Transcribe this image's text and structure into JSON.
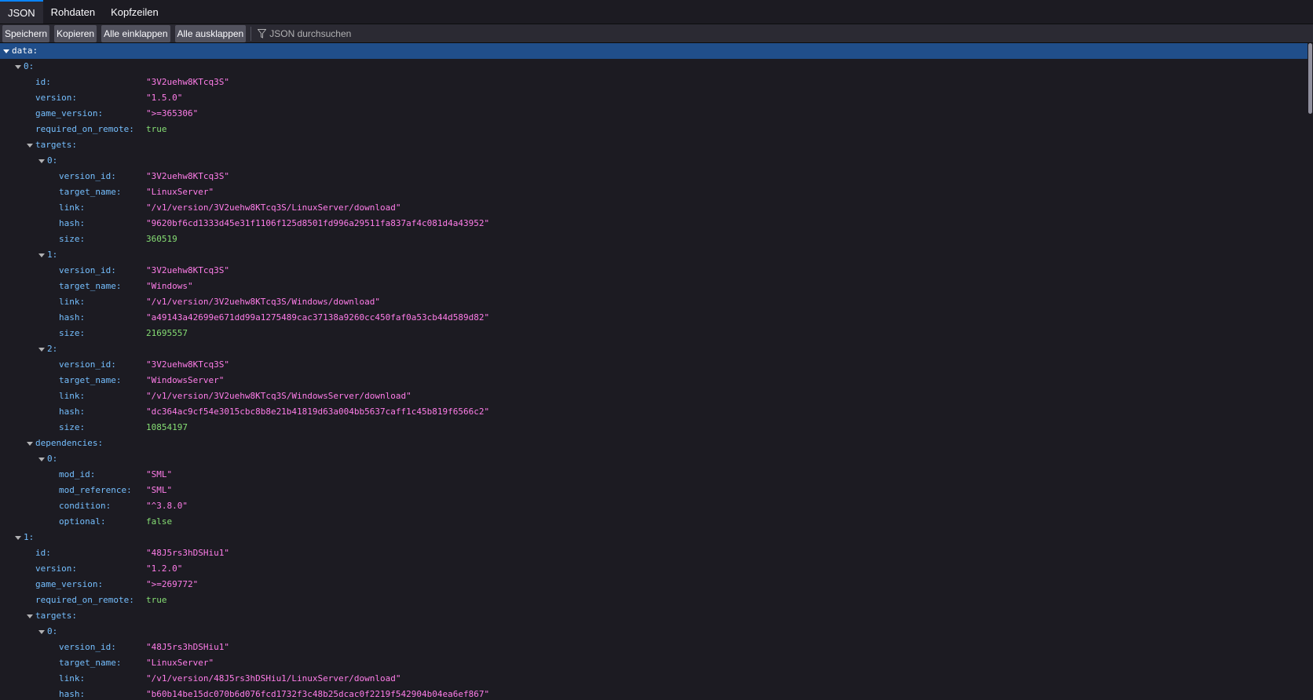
{
  "tabs": [
    {
      "label": "JSON",
      "selected": true
    },
    {
      "label": "Rohdaten",
      "selected": false
    },
    {
      "label": "Kopfzeilen",
      "selected": false
    }
  ],
  "toolbar": {
    "save_label": "Speichern",
    "copy_label": "Kopieren",
    "collapse_all_label": "Alle einklappen",
    "expand_all_label": "Alle ausklappen",
    "filter_placeholder": "JSON durchsuchen"
  },
  "tree_rows": [
    {
      "depth": 0,
      "key": "data:",
      "expander": true,
      "selected": true,
      "name": "tree-row-data"
    },
    {
      "depth": 1,
      "key": "0:",
      "expander": true
    },
    {
      "depth": 2,
      "key": "id:",
      "value": "\"3V2uehw8KTcq3S\"",
      "type": "str"
    },
    {
      "depth": 2,
      "key": "version:",
      "value": "\"1.5.0\"",
      "type": "str"
    },
    {
      "depth": 2,
      "key": "game_version:",
      "value": "\">=365306\"",
      "type": "str"
    },
    {
      "depth": 2,
      "key": "required_on_remote:",
      "value": "true",
      "type": "bool"
    },
    {
      "depth": 2,
      "key": "targets:",
      "expander": true
    },
    {
      "depth": 3,
      "key": "0:",
      "expander": true
    },
    {
      "depth": 4,
      "key": "version_id:",
      "value": "\"3V2uehw8KTcq3S\"",
      "type": "str"
    },
    {
      "depth": 4,
      "key": "target_name:",
      "value": "\"LinuxServer\"",
      "type": "str"
    },
    {
      "depth": 4,
      "key": "link:",
      "value": "\"/v1/version/3V2uehw8KTcq3S/LinuxServer/download\"",
      "type": "str"
    },
    {
      "depth": 4,
      "key": "hash:",
      "value": "\"9620bf6cd1333d45e31f1106f125d8501fd996a29511fa837af4c081d4a43952\"",
      "type": "str"
    },
    {
      "depth": 4,
      "key": "size:",
      "value": "360519",
      "type": "num"
    },
    {
      "depth": 3,
      "key": "1:",
      "expander": true
    },
    {
      "depth": 4,
      "key": "version_id:",
      "value": "\"3V2uehw8KTcq3S\"",
      "type": "str"
    },
    {
      "depth": 4,
      "key": "target_name:",
      "value": "\"Windows\"",
      "type": "str"
    },
    {
      "depth": 4,
      "key": "link:",
      "value": "\"/v1/version/3V2uehw8KTcq3S/Windows/download\"",
      "type": "str"
    },
    {
      "depth": 4,
      "key": "hash:",
      "value": "\"a49143a42699e671dd99a1275489cac37138a9260cc450faf0a53cb44d589d82\"",
      "type": "str"
    },
    {
      "depth": 4,
      "key": "size:",
      "value": "21695557",
      "type": "num"
    },
    {
      "depth": 3,
      "key": "2:",
      "expander": true
    },
    {
      "depth": 4,
      "key": "version_id:",
      "value": "\"3V2uehw8KTcq3S\"",
      "type": "str"
    },
    {
      "depth": 4,
      "key": "target_name:",
      "value": "\"WindowsServer\"",
      "type": "str"
    },
    {
      "depth": 4,
      "key": "link:",
      "value": "\"/v1/version/3V2uehw8KTcq3S/WindowsServer/download\"",
      "type": "str"
    },
    {
      "depth": 4,
      "key": "hash:",
      "value": "\"dc364ac9cf54e3015cbc8b8e21b41819d63a004bb5637caff1c45b819f6566c2\"",
      "type": "str"
    },
    {
      "depth": 4,
      "key": "size:",
      "value": "10854197",
      "type": "num"
    },
    {
      "depth": 2,
      "key": "dependencies:",
      "expander": true
    },
    {
      "depth": 3,
      "key": "0:",
      "expander": true
    },
    {
      "depth": 4,
      "key": "mod_id:",
      "value": "\"SML\"",
      "type": "str"
    },
    {
      "depth": 4,
      "key": "mod_reference:",
      "value": "\"SML\"",
      "type": "str"
    },
    {
      "depth": 4,
      "key": "condition:",
      "value": "\"^3.8.0\"",
      "type": "str"
    },
    {
      "depth": 4,
      "key": "optional:",
      "value": "false",
      "type": "bool"
    },
    {
      "depth": 1,
      "key": "1:",
      "expander": true
    },
    {
      "depth": 2,
      "key": "id:",
      "value": "\"48J5rs3hDSHiu1\"",
      "type": "str"
    },
    {
      "depth": 2,
      "key": "version:",
      "value": "\"1.2.0\"",
      "type": "str"
    },
    {
      "depth": 2,
      "key": "game_version:",
      "value": "\">=269772\"",
      "type": "str"
    },
    {
      "depth": 2,
      "key": "required_on_remote:",
      "value": "true",
      "type": "bool"
    },
    {
      "depth": 2,
      "key": "targets:",
      "expander": true
    },
    {
      "depth": 3,
      "key": "0:",
      "expander": true
    },
    {
      "depth": 4,
      "key": "version_id:",
      "value": "\"48J5rs3hDSHiu1\"",
      "type": "str"
    },
    {
      "depth": 4,
      "key": "target_name:",
      "value": "\"LinuxServer\"",
      "type": "str"
    },
    {
      "depth": 4,
      "key": "link:",
      "value": "\"/v1/version/48J5rs3hDSHiu1/LinuxServer/download\"",
      "type": "str"
    },
    {
      "depth": 4,
      "key": "hash:",
      "value": "\"b60b14be15dc070b6d076fcd1732f3c48b25dcac0f2219f542904b04ea6ef867\"",
      "type": "str"
    }
  ],
  "colors": {
    "key": "#75bfff",
    "string": "#ff7de9",
    "number_bool": "#86de74",
    "selected_row": "#204e8a",
    "background": "#1c1b22"
  }
}
